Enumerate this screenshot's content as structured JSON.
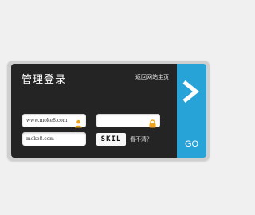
{
  "login": {
    "title": "管理登录",
    "home_link": "返回网站主页",
    "username_value": "www.moke8.com",
    "password_value": "",
    "captcha_input_value": "moke8.com",
    "captcha_text": "SKIL",
    "captcha_hint": "看不清？",
    "go_label": "GO"
  },
  "icons": {
    "user": "user-icon",
    "lock": "lock-icon",
    "arrow": "arrow-right-icon"
  },
  "colors": {
    "panel_bg": "#242424",
    "accent_blue": "#27a3d8",
    "icon_orange": "#f0a21a",
    "frame_gray": "#cfcfcf"
  }
}
